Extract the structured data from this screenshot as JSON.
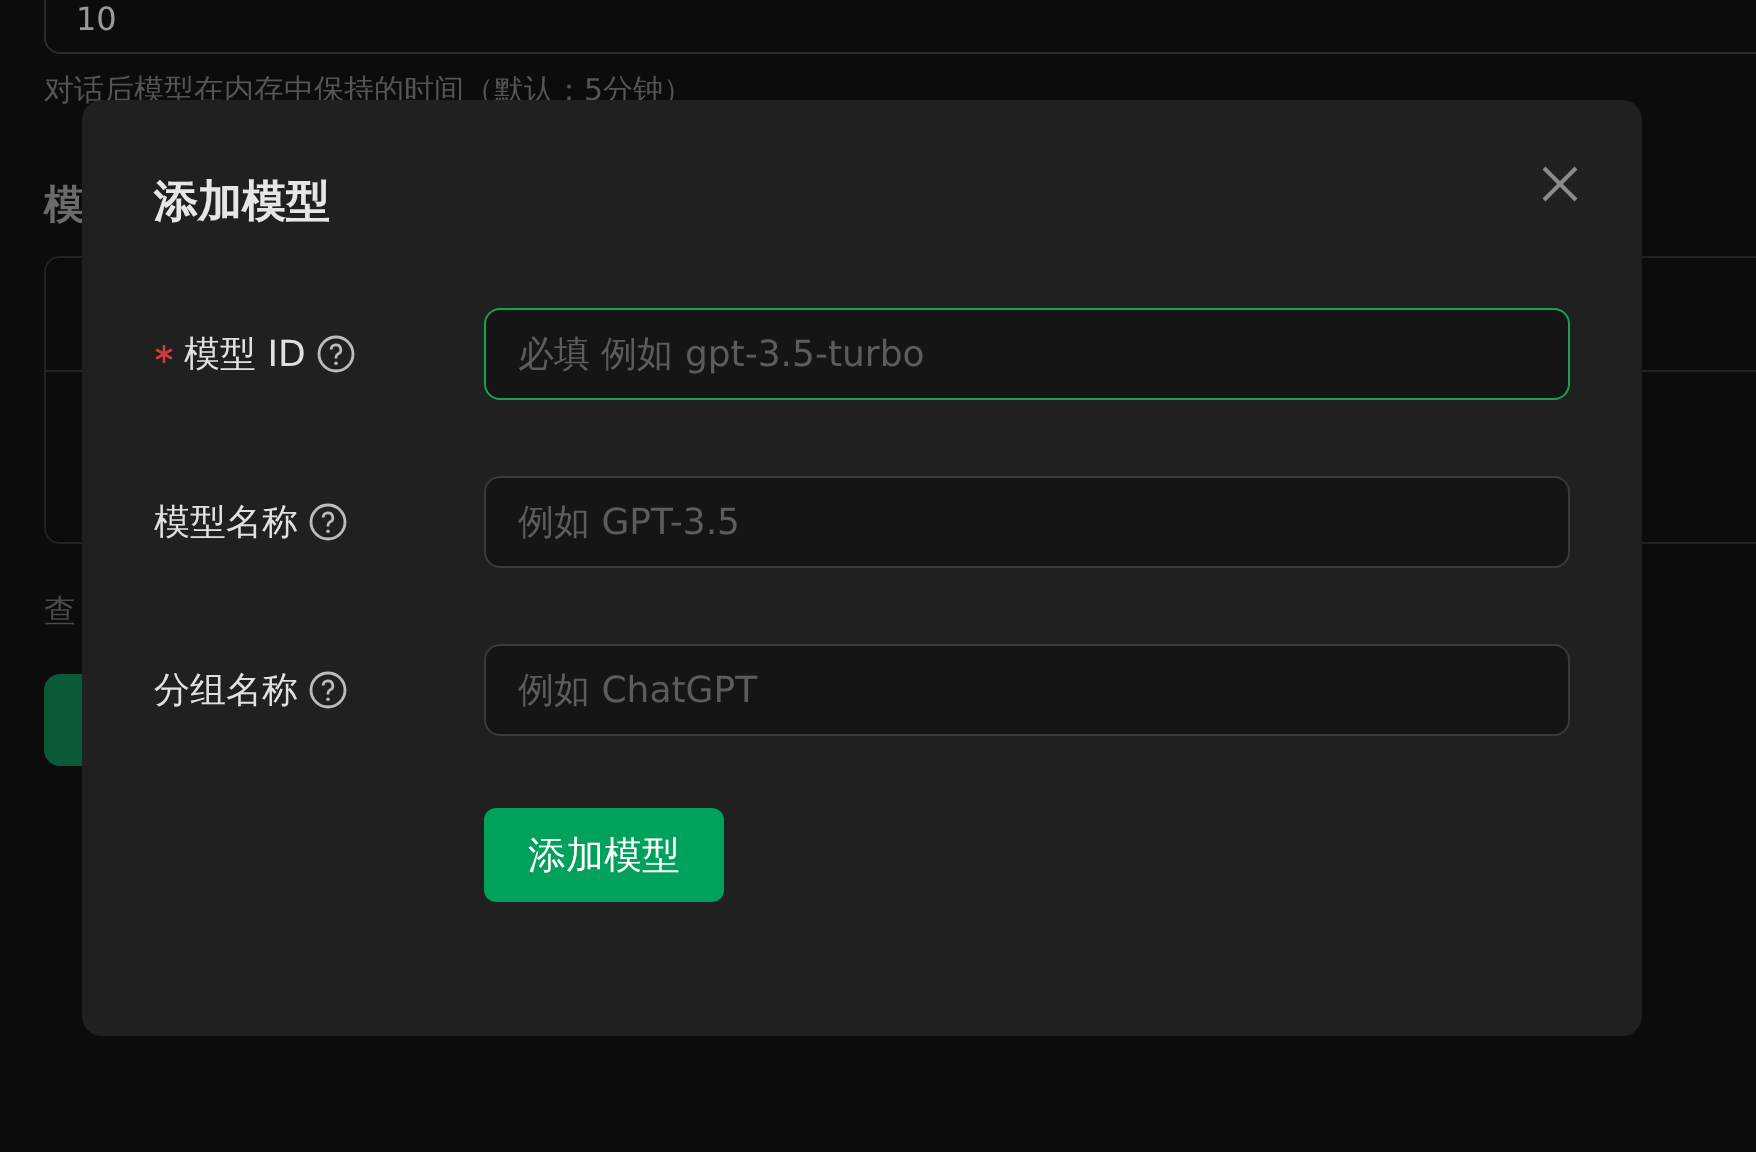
{
  "background": {
    "duration_field": {
      "value": "10"
    },
    "duration_hint": "对话后模型在内存中保持的时间（默认：5分钟）",
    "section_heading": "模",
    "footnote": "查"
  },
  "dialog": {
    "title": "添加模型",
    "fields": [
      {
        "label": "模型 ID",
        "required": true,
        "placeholder": "必填 例如 gpt-3.5-turbo",
        "focused": true
      },
      {
        "label": "模型名称",
        "required": false,
        "placeholder": "例如 GPT-3.5",
        "focused": false
      },
      {
        "label": "分组名称",
        "required": false,
        "placeholder": "例如 ChatGPT",
        "focused": false
      }
    ],
    "submit": "添加模型"
  }
}
